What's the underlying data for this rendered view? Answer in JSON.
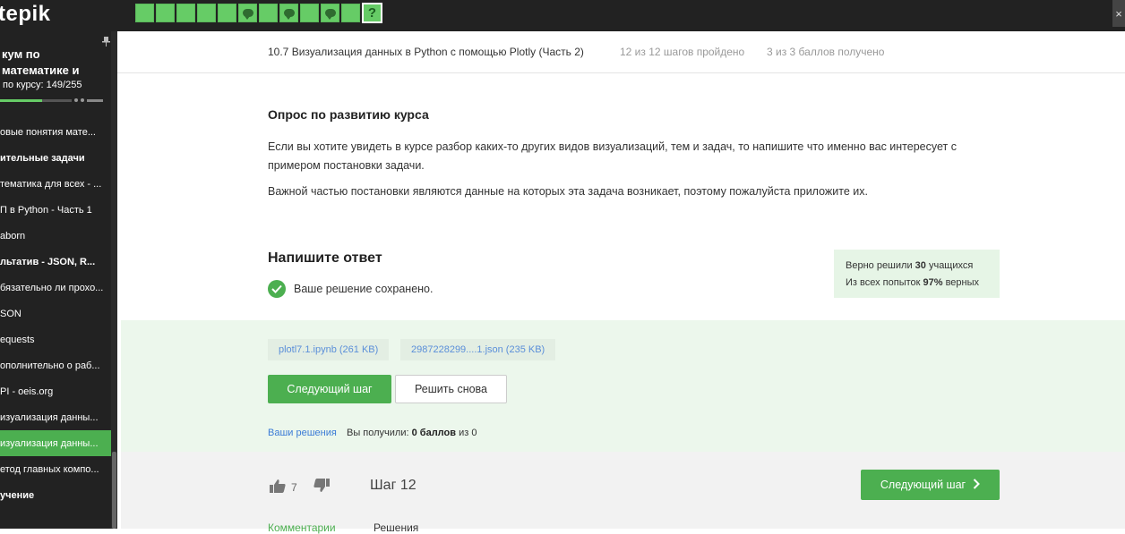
{
  "app": {
    "logo": "tepik"
  },
  "steps": [
    {
      "type": "done"
    },
    {
      "type": "done"
    },
    {
      "type": "done"
    },
    {
      "type": "done"
    },
    {
      "type": "done"
    },
    {
      "type": "comment"
    },
    {
      "type": "done"
    },
    {
      "type": "comment"
    },
    {
      "type": "done"
    },
    {
      "type": "comment"
    },
    {
      "type": "done"
    },
    {
      "type": "current",
      "label": "?"
    }
  ],
  "close_label": "×",
  "sidebar": {
    "course_title": "кум по математике и",
    "progress_label": "по курсу:  149/255",
    "progress": 0.584,
    "items": [
      {
        "label": "овые понятия мате...",
        "section": false,
        "active": false
      },
      {
        "label": "ительные задачи",
        "section": true,
        "active": false
      },
      {
        "label": "тематика для всех - ...",
        "section": false,
        "active": false
      },
      {
        "label": "П в Python - Часть 1",
        "section": false,
        "active": false
      },
      {
        "label": "aborn",
        "section": false,
        "active": false
      },
      {
        "label": "льтатив - JSON, R...",
        "section": true,
        "active": false
      },
      {
        "label": "бязательно ли прохо...",
        "section": false,
        "active": false
      },
      {
        "label": "SON",
        "section": false,
        "active": false
      },
      {
        "label": "equests",
        "section": false,
        "active": false
      },
      {
        "label": "ополнительно о раб...",
        "section": false,
        "active": false
      },
      {
        "label": "PI - oeis.org",
        "section": false,
        "active": false
      },
      {
        "label": "изуализация данны...",
        "section": false,
        "active": false
      },
      {
        "label": "изуализация данны...",
        "section": false,
        "active": true
      },
      {
        "label": "етод главных компо...",
        "section": false,
        "active": false
      },
      {
        "label": "учение",
        "section": true,
        "active": false
      }
    ]
  },
  "lesson": {
    "title": "10.7 Визуализация данных в Python с помощью Plotly (Часть 2)",
    "steps_passed": "12 из 12 шагов пройдено",
    "score": "3 из 3 баллов  получено"
  },
  "content": {
    "heading": "Опрос по развитию курса",
    "paragraph1": "Если вы хотите увидеть в курсе разбор каких-то других видов визуализаций, тем и задач, то напишите что именно вас интересует с примером постановки задачи.",
    "paragraph2": "Важной частью постановки являются данные на которых эта задача возникает, поэтому пожалуйста приложите их."
  },
  "answer": {
    "heading": "Напишите ответ",
    "saved_text": "Ваше решение сохранено.",
    "stats": {
      "solved_prefix": "Верно решили ",
      "solved_count": "30",
      "solved_suffix": " учащихся",
      "attempts_prefix": "Из всех попыток ",
      "attempts_pct": "97%",
      "attempts_suffix": " верных"
    },
    "files": [
      "plotl7.1.ipynb (261 KB)",
      "2987228299....1.json (235 KB)"
    ],
    "next_button": "Следующий шаг",
    "retry_button": "Решить снова",
    "your_solutions": "Ваши решения",
    "got_prefix": "Вы получили: ",
    "got_points": "0 баллов",
    "got_suffix": " из 0"
  },
  "footer": {
    "likes": "7",
    "step_label": "Шаг 12",
    "next_button": "Следующий шаг",
    "tabs": [
      "Комментарии",
      "Решения"
    ]
  }
}
